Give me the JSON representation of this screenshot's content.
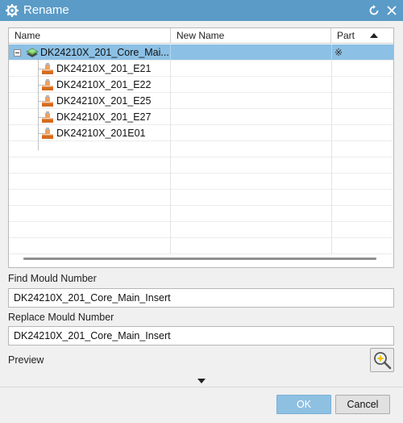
{
  "window": {
    "title": "Rename",
    "icons": {
      "settings": "gear-icon",
      "reset": "reset-icon",
      "close": "close-icon"
    }
  },
  "table": {
    "columns": {
      "name": "Name",
      "new_name": "New Name",
      "part": "Part"
    },
    "sort": "ascending",
    "rows": [
      {
        "name": "DK24210X_201_Core_Mai...",
        "new_name": "",
        "part": "※",
        "level": 0,
        "expanded": true,
        "selected": true,
        "icon": "assembly-icon"
      },
      {
        "name": "DK24210X_201_E21",
        "new_name": "",
        "part": "",
        "level": 1,
        "icon": "component-icon"
      },
      {
        "name": "DK24210X_201_E22",
        "new_name": "",
        "part": "",
        "level": 1,
        "icon": "component-icon"
      },
      {
        "name": "DK24210X_201_E25",
        "new_name": "",
        "part": "",
        "level": 1,
        "icon": "component-icon"
      },
      {
        "name": "DK24210X_201_E27",
        "new_name": "",
        "part": "",
        "level": 1,
        "icon": "component-icon"
      },
      {
        "name": "DK24210X_201E01",
        "new_name": "",
        "part": "",
        "level": 1,
        "icon": "component-icon"
      }
    ]
  },
  "find": {
    "label": "Find Mould Number",
    "value": "DK24210X_201_Core_Main_Insert"
  },
  "replace": {
    "label": "Replace Mould Number",
    "value": "DK24210X_201_Core_Main_Insert"
  },
  "preview": {
    "label": "Preview",
    "icon": "preview-magnifier-icon"
  },
  "buttons": {
    "ok": "OK",
    "cancel": "Cancel"
  },
  "colors": {
    "titlebar": "#5a9bc7",
    "selection": "#8cc0e4",
    "ok_button": "#8ec0e2"
  }
}
